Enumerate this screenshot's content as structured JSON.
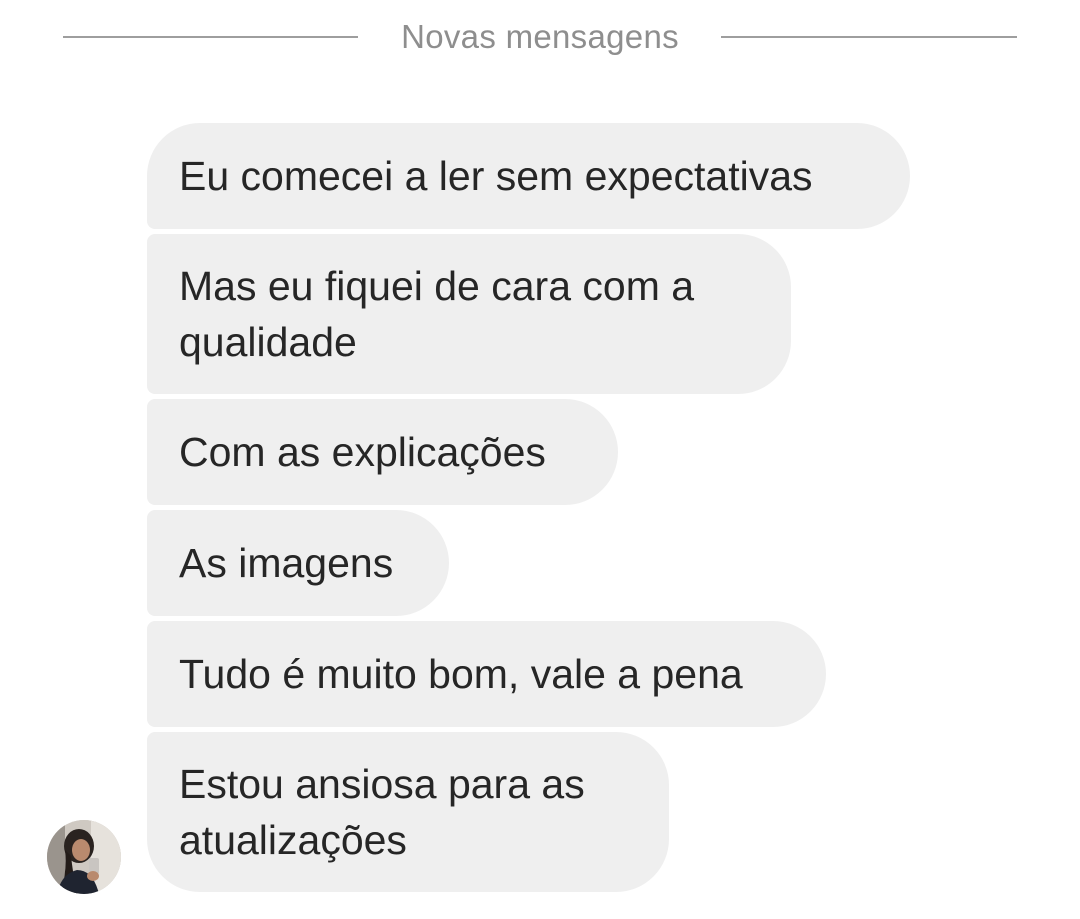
{
  "divider": {
    "label": "Novas mensagens"
  },
  "messages": [
    {
      "text": "Eu comecei a ler sem expectativas"
    },
    {
      "text": "Mas eu fiquei de cara com a\nqualidade"
    },
    {
      "text": "Com as explicações"
    },
    {
      "text": "As imagens"
    },
    {
      "text": "Tudo é muito bom, vale a pena"
    },
    {
      "text": "Estou ansiosa para as\natualizações"
    }
  ],
  "sender": {
    "avatar_icon": "profile-photo-avatar"
  },
  "colors": {
    "bubble_background": "#efefef",
    "message_text": "#262626",
    "divider_text": "#8e8e8e",
    "divider_line": "#9e9e9e"
  }
}
